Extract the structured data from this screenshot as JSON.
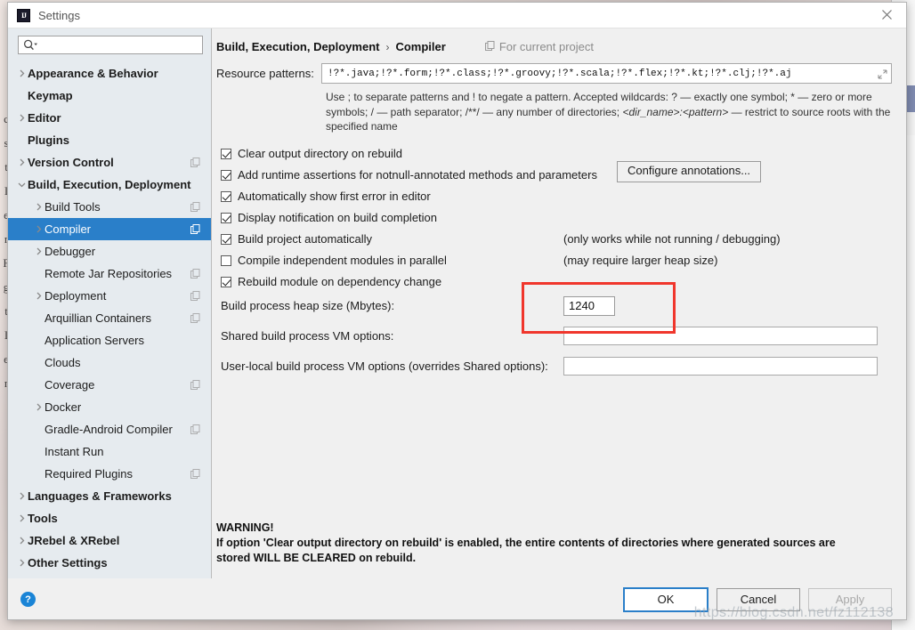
{
  "window": {
    "title": "Settings",
    "logo_icon": "intellij-logo-icon",
    "close_icon": "close-icon"
  },
  "sidebar": {
    "search": {
      "placeholder": "",
      "value": "",
      "icon": "search-icon"
    },
    "items": [
      {
        "label": "Appearance & Behavior",
        "level": 0,
        "bold": true,
        "arrow": "right",
        "config": false,
        "selected": false
      },
      {
        "label": "Keymap",
        "level": 0,
        "bold": true,
        "arrow": "none",
        "config": false,
        "selected": false
      },
      {
        "label": "Editor",
        "level": 0,
        "bold": true,
        "arrow": "right",
        "config": false,
        "selected": false
      },
      {
        "label": "Plugins",
        "level": 0,
        "bold": true,
        "arrow": "none",
        "config": false,
        "selected": false
      },
      {
        "label": "Version Control",
        "level": 0,
        "bold": true,
        "arrow": "right",
        "config": true,
        "selected": false
      },
      {
        "label": "Build, Execution, Deployment",
        "level": 0,
        "bold": true,
        "arrow": "down",
        "config": false,
        "selected": false
      },
      {
        "label": "Build Tools",
        "level": 1,
        "bold": false,
        "arrow": "right",
        "config": true,
        "selected": false
      },
      {
        "label": "Compiler",
        "level": 1,
        "bold": false,
        "arrow": "right",
        "config": true,
        "selected": true
      },
      {
        "label": "Debugger",
        "level": 1,
        "bold": false,
        "arrow": "right",
        "config": false,
        "selected": false
      },
      {
        "label": "Remote Jar Repositories",
        "level": 1,
        "bold": false,
        "arrow": "none",
        "config": true,
        "selected": false
      },
      {
        "label": "Deployment",
        "level": 1,
        "bold": false,
        "arrow": "right",
        "config": true,
        "selected": false
      },
      {
        "label": "Arquillian Containers",
        "level": 1,
        "bold": false,
        "arrow": "none",
        "config": true,
        "selected": false
      },
      {
        "label": "Application Servers",
        "level": 1,
        "bold": false,
        "arrow": "none",
        "config": false,
        "selected": false
      },
      {
        "label": "Clouds",
        "level": 1,
        "bold": false,
        "arrow": "none",
        "config": false,
        "selected": false
      },
      {
        "label": "Coverage",
        "level": 1,
        "bold": false,
        "arrow": "none",
        "config": true,
        "selected": false
      },
      {
        "label": "Docker",
        "level": 1,
        "bold": false,
        "arrow": "right",
        "config": false,
        "selected": false
      },
      {
        "label": "Gradle-Android Compiler",
        "level": 1,
        "bold": false,
        "arrow": "none",
        "config": true,
        "selected": false
      },
      {
        "label": "Instant Run",
        "level": 1,
        "bold": false,
        "arrow": "none",
        "config": false,
        "selected": false
      },
      {
        "label": "Required Plugins",
        "level": 1,
        "bold": false,
        "arrow": "none",
        "config": true,
        "selected": false
      },
      {
        "label": "Languages & Frameworks",
        "level": 0,
        "bold": true,
        "arrow": "right",
        "config": false,
        "selected": false
      },
      {
        "label": "Tools",
        "level": 0,
        "bold": true,
        "arrow": "right",
        "config": false,
        "selected": false
      },
      {
        "label": "JRebel & XRebel",
        "level": 0,
        "bold": true,
        "arrow": "right",
        "config": false,
        "selected": false
      },
      {
        "label": "Other Settings",
        "level": 0,
        "bold": true,
        "arrow": "right",
        "config": false,
        "selected": false
      }
    ]
  },
  "main": {
    "breadcrumb": {
      "parent": "Build, Execution, Deployment",
      "separator": "›",
      "current": "Compiler",
      "scope_label": "For current project",
      "scope_icon": "copy-settings-icon"
    },
    "resource_patterns": {
      "label": "Resource patterns:",
      "value": "!?*.java;!?*.form;!?*.class;!?*.groovy;!?*.scala;!?*.flex;!?*.kt;!?*.clj;!?*.aj",
      "placeholder": "",
      "expand_icon": "expand-icon",
      "hint_part1": "Use ; to separate patterns and ! to negate a pattern. Accepted wildcards: ? — exactly one symbol; * — zero or more symbols; / — path separator; /**/ — any number of directories; ",
      "hint_italic": "<dir_name>:<pattern>",
      "hint_part2": " — restrict to source roots with the specified name"
    },
    "checkboxes": [
      {
        "label": "Clear output directory on rebuild",
        "checked": true,
        "note": ""
      },
      {
        "label": "Add runtime assertions for notnull-annotated methods and parameters",
        "checked": true,
        "note": ""
      },
      {
        "label": "Automatically show first error in editor",
        "checked": true,
        "note": ""
      },
      {
        "label": "Display notification on build completion",
        "checked": true,
        "note": ""
      },
      {
        "label": "Build project automatically",
        "checked": true,
        "note": "(only works while not running / debugging)"
      },
      {
        "label": "Compile independent modules in parallel",
        "checked": false,
        "note": "(may require larger heap size)"
      },
      {
        "label": "Rebuild module on dependency change",
        "checked": true,
        "note": ""
      }
    ],
    "configure_annotations_button": "Configure annotations...",
    "heap": {
      "label": "Build process heap size (Mbytes):",
      "value": "1240"
    },
    "shared_vm": {
      "label": "Shared build process VM options:",
      "value": "",
      "placeholder": ""
    },
    "user_vm": {
      "label": "User-local build process VM options (overrides Shared options):",
      "value": "",
      "placeholder": ""
    },
    "warning": {
      "title": "WARNING!",
      "line1": "If option 'Clear output directory on rebuild' is enabled, the entire contents of directories where generated sources are",
      "line2": "stored WILL BE CLEARED on rebuild."
    },
    "highlight_color": "#f0362c"
  },
  "footer": {
    "help_label": "?",
    "ok": "OK",
    "cancel": "Cancel",
    "apply": "Apply",
    "watermark": "https://blog.csdn.net/fz112138"
  },
  "theme": {
    "selection_blue": "#2a7fc9",
    "sidebar_bg": "#e6ebef",
    "panel_bg": "#f0f0f0"
  }
}
